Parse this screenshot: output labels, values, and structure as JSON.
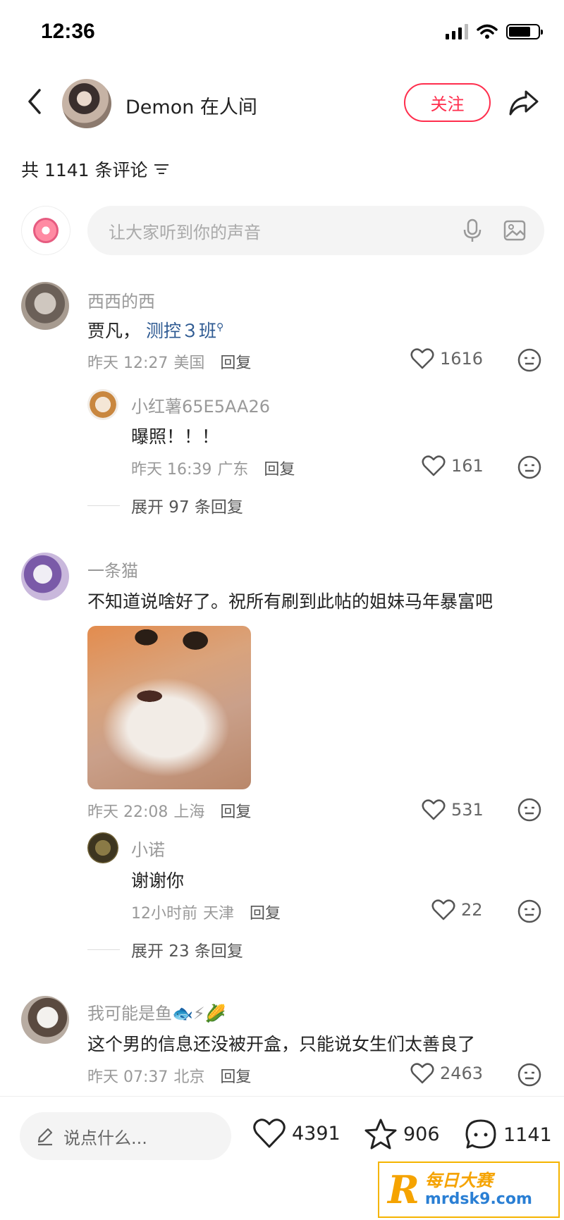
{
  "status_bar": {
    "time": "12:36"
  },
  "header": {
    "author_name": "Demon 在人间",
    "follow_label": "关注"
  },
  "comment_count_label": "共 1141 条评论",
  "top_input": {
    "placeholder": "让大家听到你的声音"
  },
  "comments": [
    {
      "name": "西西的西",
      "text_prefix": "贾凡，",
      "mention": "测控３班",
      "time": "昨天 12:27",
      "location": "美国",
      "reply_label": "回复",
      "likes": "1616",
      "replies": [
        {
          "name": "小红薯65E5AA26",
          "text": "曝照！！！",
          "time": "昨天 16:39",
          "location": "广东",
          "reply_label": "回复",
          "likes": "161"
        }
      ],
      "expand_label": "展开 97 条回复"
    },
    {
      "name": "一条猫",
      "text": "不知道说啥好了。祝所有刷到此帖的姐妹马年暴富吧",
      "image": "cat-photo",
      "time": "昨天 22:08",
      "location": "上海",
      "reply_label": "回复",
      "likes": "531",
      "replies": [
        {
          "name": "小诺",
          "text": "谢谢你",
          "time": "12小时前",
          "location": "天津",
          "reply_label": "回复",
          "likes": "22"
        }
      ],
      "expand_label": "展开 23 条回复"
    },
    {
      "name": "我可能是鱼🐟⚡🌽",
      "text": "这个男的信息还没被开盒，只能说女生们太善良了",
      "time": "昨天 07:37",
      "location": "北京",
      "reply_label": "回复",
      "likes": "2463"
    }
  ],
  "bottom_bar": {
    "input_placeholder": "说点什么...",
    "likes": "4391",
    "stars": "906",
    "comments": "1141"
  },
  "watermark": {
    "name": "每日大赛",
    "url": "mrdsk9.com",
    "logo_letter": "R"
  },
  "colors": {
    "accent": "#ff2e4d",
    "mention": "#2e5a92",
    "muted": "#999999",
    "watermark": "#f5a300"
  }
}
